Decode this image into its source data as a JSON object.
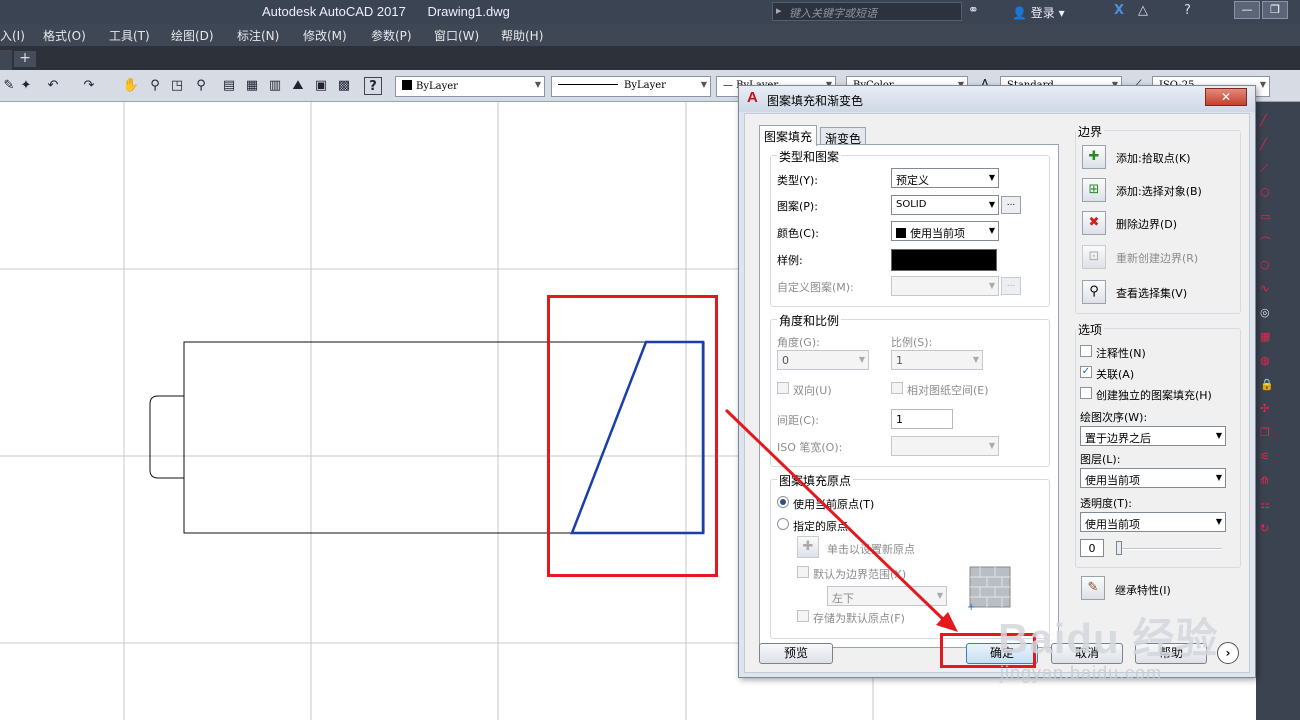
{
  "window": {
    "app_title": "Autodesk AutoCAD 2017",
    "file_name": "Drawing1.dwg",
    "search_placeholder": "键入关键字或短语",
    "login_label": "登录"
  },
  "menu": [
    "入(I)",
    "格式(O)",
    "工具(T)",
    "绘图(D)",
    "标注(N)",
    "修改(M)",
    "参数(P)",
    "窗口(W)",
    "帮助(H)"
  ],
  "toolbar": {
    "color_combo": "ByLayer",
    "linetype_combo": "ByLayer",
    "lineweight_combo": "— ByLayer",
    "plotstyle_combo": "ByColor",
    "textstyle_combo": "Standard",
    "dimstyle_combo": "ISO-25"
  },
  "dialog": {
    "title": "图案填充和渐变色",
    "close_label": "✕",
    "tabs": [
      "图案填充",
      "渐变色"
    ],
    "type_pattern": {
      "title": "类型和图案",
      "type_label": "类型(Y):",
      "type_value": "预定义",
      "pattern_label": "图案(P):",
      "pattern_value": "SOLID",
      "color_label": "颜色(C):",
      "color_value": "使用当前项",
      "sample_label": "样例:",
      "custom_label": "自定义图案(M):"
    },
    "angle_scale": {
      "title": "角度和比例",
      "angle_label": "角度(G):",
      "angle_value": "0",
      "scale_label": "比例(S):",
      "scale_value": "1",
      "double_label": "双向(U)",
      "relative_label": "相对图纸空间(E)",
      "spacing_label": "间距(C):",
      "spacing_value": "1",
      "iso_label": "ISO 笔宽(O):"
    },
    "origin": {
      "title": "图案填充原点",
      "use_current": "使用当前原点(T)",
      "specified": "指定的原点",
      "click_set": "单击以设置新原点",
      "default_extent": "默认为边界范围(X)",
      "extent_value": "左下",
      "store_default": "存储为默认原点(F)"
    },
    "boundary": {
      "title": "边界",
      "add_pick": "添加:拾取点(K)",
      "add_select": "添加:选择对象(B)",
      "remove": "删除边界(D)",
      "recreate": "重新创建边界(R)",
      "view_selection": "查看选择集(V)"
    },
    "options": {
      "title": "选项",
      "annotative": "注释性(N)",
      "associative": "关联(A)",
      "separate": "创建独立的图案填充(H)",
      "draw_order_label": "绘图次序(W):",
      "draw_order_value": "置于边界之后",
      "layer_label": "图层(L):",
      "layer_value": "使用当前项",
      "transparency_label": "透明度(T):",
      "transparency_value": "使用当前项",
      "transparency_number": "0"
    },
    "inherit": "继承特性(I)",
    "buttons": {
      "preview": "预览",
      "ok": "确定",
      "cancel": "取消",
      "help": "帮助"
    }
  },
  "watermark": {
    "main": "Baidu 经验",
    "url": "jingyan.baidu.com"
  },
  "colors": {
    "accent_red": "#e3191f",
    "shape_blue": "#1b3fa8",
    "ui_dark": "#3b4453"
  }
}
